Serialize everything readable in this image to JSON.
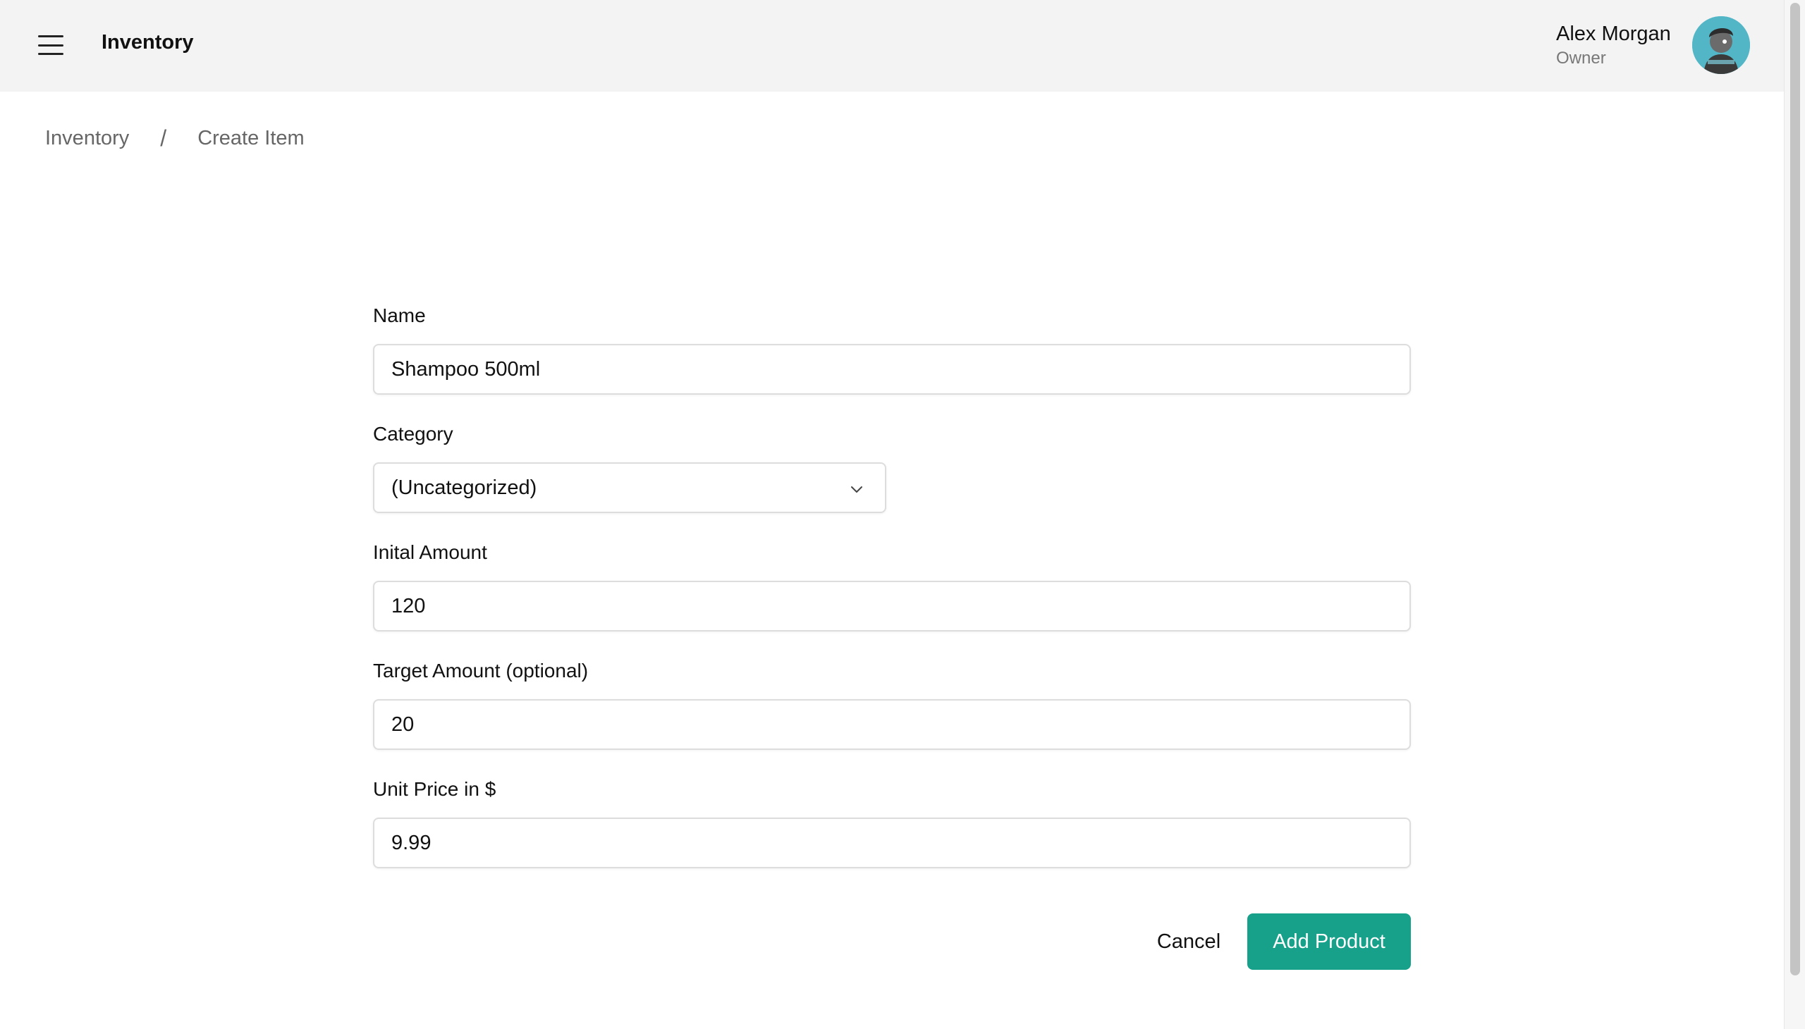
{
  "header": {
    "app_title": "Inventory",
    "menu_icon": "hamburger-menu-icon",
    "user": {
      "name": "Alex Morgan",
      "role": "Owner",
      "avatar_icon": "user-avatar"
    }
  },
  "breadcrumb": {
    "items": [
      "Inventory",
      "Create Item"
    ],
    "separator": "/"
  },
  "form": {
    "name": {
      "label": "Name",
      "value": "Shampoo 500ml"
    },
    "category": {
      "label": "Category",
      "value": "(Uncategorized)",
      "icon": "chevron-down-icon"
    },
    "initial_amount": {
      "label": "Inital Amount",
      "value": "120"
    },
    "target_amount": {
      "label": "Target Amount (optional)",
      "value": "20"
    },
    "unit_price": {
      "label": "Unit Price in $",
      "value": "9.99"
    }
  },
  "actions": {
    "cancel_label": "Cancel",
    "submit_label": "Add Product"
  },
  "colors": {
    "primary": "#17a08a",
    "header_bg": "#f3f3f3",
    "avatar_bg": "#52b6c7"
  }
}
